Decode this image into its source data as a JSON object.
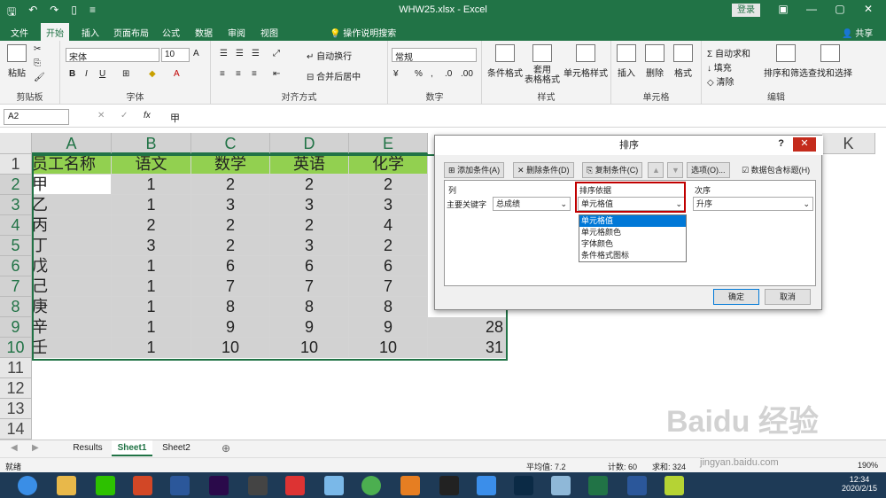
{
  "window": {
    "title": "WHW25.xlsx  -  Excel",
    "login": "登录",
    "share": "共享"
  },
  "tabs": [
    "文件",
    "开始",
    "插入",
    "页面布局",
    "公式",
    "数据",
    "审阅",
    "视图",
    "操作说明搜索"
  ],
  "ribbon": {
    "clipboard": {
      "paste": "粘贴",
      "label": "剪贴板"
    },
    "font": {
      "name": "宋体",
      "size": "10",
      "label": "字体"
    },
    "alignment": {
      "wrap": "自动换行",
      "merge": "合并后居中",
      "label": "对齐方式"
    },
    "number": {
      "format": "常规",
      "label": "数字"
    },
    "styles": {
      "cond": "条件格式",
      "table": "套用\n表格格式",
      "cell": "单元格样式",
      "label": "样式"
    },
    "cells": {
      "insert": "插入",
      "delete": "删除",
      "format": "格式",
      "label": "单元格"
    },
    "editing": {
      "autosum": "自动求和",
      "fill": "填充",
      "clear": "清除",
      "sort": "排序和筛选",
      "find": "查找和选择",
      "label": "编辑"
    }
  },
  "formula_bar": {
    "name_box": "A2",
    "fx": "fx",
    "value": "甲"
  },
  "columns": [
    "A",
    "B",
    "C",
    "D",
    "E",
    "F",
    "G",
    "H",
    "I",
    "J",
    "K"
  ],
  "rows": [
    "1",
    "2",
    "3",
    "4",
    "5",
    "6",
    "7",
    "8",
    "9",
    "10",
    "11",
    "12",
    "13",
    "14"
  ],
  "table": {
    "header": [
      "员工名称",
      "语文",
      "数学",
      "英语",
      "化学"
    ],
    "data": [
      [
        "甲",
        "1",
        "2",
        "2",
        "2"
      ],
      [
        "乙",
        "1",
        "3",
        "3",
        "3"
      ],
      [
        "丙",
        "2",
        "2",
        "2",
        "4"
      ],
      [
        "丁",
        "3",
        "2",
        "3",
        "2"
      ],
      [
        "戊",
        "1",
        "6",
        "6",
        "6"
      ],
      [
        "己",
        "1",
        "7",
        "7",
        "7"
      ],
      [
        "庚",
        "1",
        "8",
        "8",
        "8"
      ],
      [
        "辛",
        "1",
        "9",
        "9",
        "9"
      ],
      [
        "壬",
        "1",
        "10",
        "10",
        "10"
      ]
    ],
    "f_visible": [
      "",
      "",
      "",
      "",
      "",
      "",
      "",
      "28",
      "31"
    ]
  },
  "dialog": {
    "title": "排序",
    "add": "添加条件(A)",
    "delete": "删除条件(D)",
    "copy": "复制条件(C)",
    "options": "选项(O)...",
    "has_header": "数据包含标题(H)",
    "col_header": "列",
    "sort_on_header": "排序依据",
    "order_header": "次序",
    "key_label": "主要关键字",
    "key_value": "总成绩",
    "sort_on_value": "单元格值",
    "order_value": "升序",
    "dropdown": [
      "单元格值",
      "单元格颜色",
      "字体颜色",
      "条件格式图标"
    ],
    "ok": "确定",
    "cancel": "取消"
  },
  "sheets": [
    "Results",
    "Sheet1",
    "Sheet2"
  ],
  "status": {
    "ready": "就绪",
    "avg": "平均值: 7.2",
    "count": "计数: 60",
    "sum": "求和: 324",
    "zoom": "190%"
  },
  "clock": {
    "time": "12:34",
    "date": "2020/2/15"
  },
  "watermark": {
    "text": "Baidu 经验",
    "url": "jingyan.baidu.com"
  }
}
